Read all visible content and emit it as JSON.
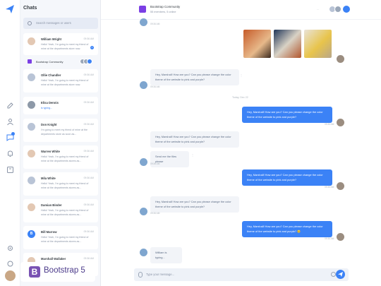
{
  "sidebar": {
    "title": "Chats",
    "search_placeholder": "Search messages or users",
    "chats": [
      {
        "name": "William Wright",
        "time": "09:36 AM",
        "preview": "Hello! Yeah, I'm going to meet my friend of mine at the departments store now.",
        "unread": "1"
      },
      {
        "name": "Bootstrap Community",
        "time": "",
        "preview": "",
        "unread": ""
      },
      {
        "name": "Ollie Chandler",
        "time": "09:36 AM",
        "preview": "Hello! Yeah, I'm going to meet my friend of mine at the departments store now.",
        "unread": ""
      },
      {
        "name": "Elisa Dennis",
        "time": "09:36 AM",
        "preview": "is typing...",
        "unread": ""
      },
      {
        "name": "Don Knight",
        "time": "09:36 AM",
        "preview": "I'm going to meet my friend of mine at the departments store as soon as...",
        "unread": ""
      },
      {
        "name": "Warren White",
        "time": "09:36 AM",
        "preview": "Hello! Yeah, I'm going to meet my friend of mine at the departments stores as...",
        "unread": ""
      },
      {
        "name": "Mila White",
        "time": "09:36 AM",
        "preview": "Hello! Yeah, I'm going to meet my friend of mine at the departments stores as...",
        "unread": ""
      },
      {
        "name": "Damian Binder",
        "time": "09:36 AM",
        "preview": "Hello! Yeah, I'm going to meet my friend of mine at the departments stores as...",
        "unread": ""
      },
      {
        "name": "Bill Marrow",
        "time": "09:36 AM",
        "preview": "Hello! Yeah, I'm going to meet my friend of mine at the departments stores as...",
        "unread": ""
      },
      {
        "name": "Marshall Wallaker",
        "time": "09:36 AM",
        "preview": "",
        "unread": ""
      }
    ]
  },
  "badge": {
    "letter": "B",
    "text": "Bootstrap 5"
  },
  "header": {
    "name": "Bootstrap Community",
    "sub": "55 members, 5 online",
    "more": "..."
  },
  "messages": {
    "m1_time": "09:36 AM",
    "m_photos_time": "",
    "m2_text": "Hey, Marshall! How are you? Can you please change the color theme of the website to pink and purple?",
    "m2_time": "09:36 AM",
    "date_sep": "Today, Dec 22",
    "m3_text": "Hey, Marshall! How are you? Can you please change the color theme of the website to pink and purple?",
    "m3_time": "09:36 AM",
    "m4_text": "Hey, Marshall! How are you? Can you please change the color theme of the website to pink and purple?",
    "m4_time": "09:36 AM",
    "m5_text": "Send me the files please",
    "m5_time": "09:36 AM",
    "m6_text": "Hey, Marshall! How are you? Can you please change the color theme of the website to pink and purple?",
    "m6_time": "09:36 AM",
    "m7_text": "Hey, Marshall! How are you? Can you please change the color theme of the website to pink and purple?",
    "m7_time": "09:36 AM",
    "m8_text": "Hey, Marshall! How are you? Can you please change the color theme of the website to pink and purple? 😊",
    "m8_time": "09:36 AM",
    "typing": "William is typing..."
  },
  "composer": {
    "placeholder": "Type your message..."
  },
  "colors": {
    "accent": "#3b82f6",
    "brand": "#7952b3"
  }
}
